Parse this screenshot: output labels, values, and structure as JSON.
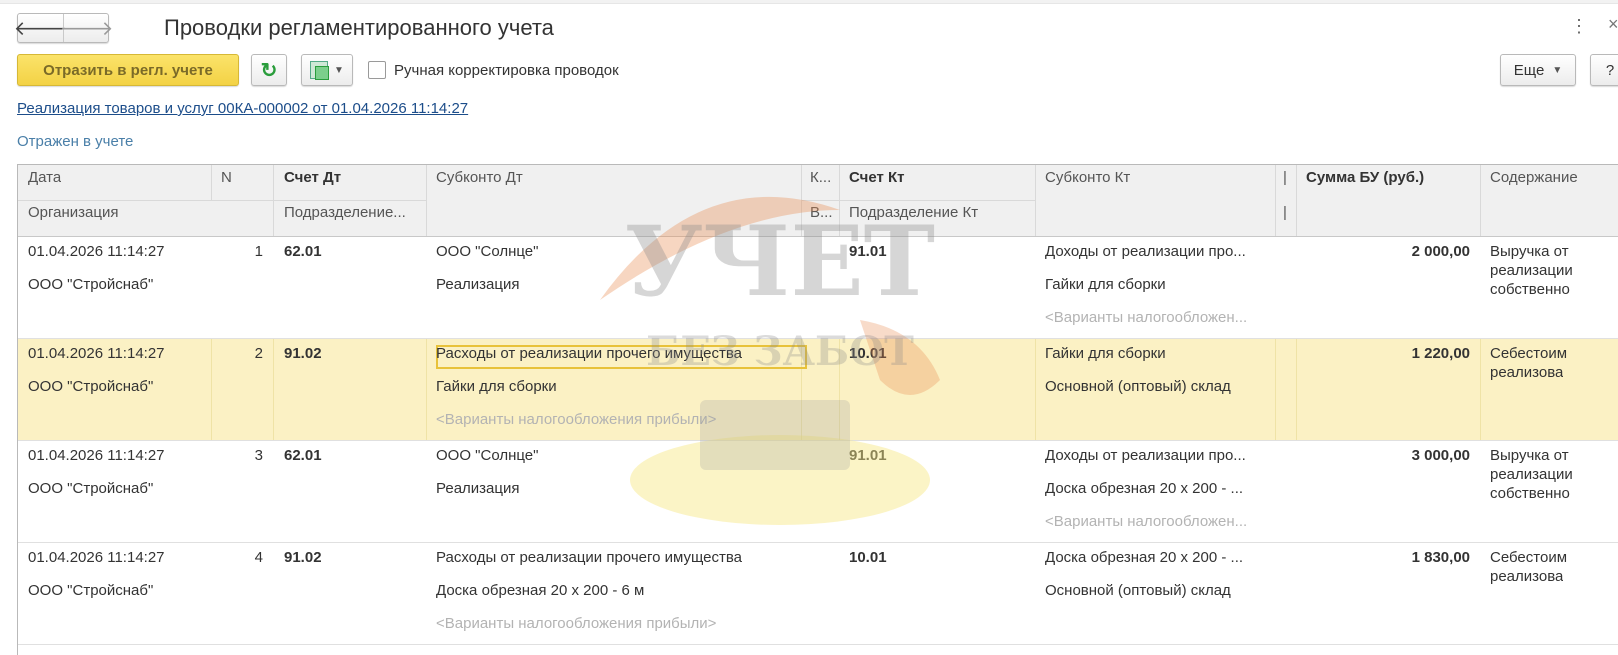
{
  "window": {
    "title": "Проводки регламентированного учета",
    "back_icon": "arrow-left-icon",
    "forward_icon": "arrow-right-icon"
  },
  "toolbar": {
    "post_label": "Отразить в регл. учете",
    "manual_label": "Ручная корректировка проводок",
    "more_label": "Еще",
    "help_label": "?"
  },
  "document_link": "Реализация товаров и услуг 00КА-000002 от 01.04.2026 11:14:27",
  "status": "Отражен в учете",
  "columns": {
    "date": "Дата",
    "n": "N",
    "account_dt": "Счет Дт",
    "subconto_dt": "Субконто Дт",
    "k": "К...",
    "account_kt": "Счет Кт",
    "subconto_kt": "Субконто Кт",
    "sep": "|",
    "amount": "Сумма БУ (руб.)",
    "content": "Содержание",
    "org": "Организация",
    "division_dt": "Подразделение...",
    "v": "В...",
    "division_kt": "Подразделение Кт"
  },
  "rows": [
    {
      "date": "01.04.2026 11:14:27",
      "n": "1",
      "dt": "62.01",
      "sub_dt1": "ООО \"Солнце\"",
      "sub_dt2": "Реализация",
      "sub_dt3": "",
      "kt": "91.01",
      "sub_kt1": "Доходы от реализации про...",
      "sub_kt2": "Гайки для сборки",
      "sub_kt3": "<Варианты налогообложен...",
      "org": "ООО \"Стройснаб\"",
      "amount": "2 000,00",
      "content1": "Выручка от",
      "content2": "реализации",
      "content3": "собственно"
    },
    {
      "date": "01.04.2026 11:14:27",
      "n": "2",
      "dt": "91.02",
      "sub_dt1": "Расходы от реализации прочего имущества",
      "sub_dt2": "Гайки для сборки",
      "sub_dt3": "<Варианты налогообложения прибыли>",
      "kt": "10.01",
      "sub_kt1": "Гайки для сборки",
      "sub_kt2": "Основной (оптовый) склад",
      "sub_kt3": "",
      "org": "ООО \"Стройснаб\"",
      "amount": "1 220,00",
      "content1": "Себестоим",
      "content2": "реализова",
      "content3": ""
    },
    {
      "date": "01.04.2026 11:14:27",
      "n": "3",
      "dt": "62.01",
      "sub_dt1": "ООО \"Солнце\"",
      "sub_dt2": "Реализация",
      "sub_dt3": "",
      "kt": "91.01",
      "sub_kt1": "Доходы от реализации про...",
      "sub_kt2": "Доска обрезная 20 х 200 - ...",
      "sub_kt3": "<Варианты налогообложен...",
      "org": "ООО \"Стройснаб\"",
      "amount": "3 000,00",
      "content1": "Выручка от",
      "content2": "реализации",
      "content3": "собственно"
    },
    {
      "date": "01.04.2026 11:14:27",
      "n": "4",
      "dt": "91.02",
      "sub_dt1": "Расходы от реализации прочего имущества",
      "sub_dt2": "Доска обрезная 20 х 200 - 6 м",
      "sub_dt3": "<Варианты налогообложения прибыли>",
      "kt": "10.01",
      "sub_kt1": "Доска обрезная 20 х 200 - ...",
      "sub_kt2": "Основной (оптовый) склад",
      "sub_kt3": "",
      "org": "ООО \"Стройснаб\"",
      "amount": "1 830,00",
      "content1": "Себестоим",
      "content2": "реализова",
      "content3": ""
    }
  ],
  "watermark": {
    "line1": "УЧЕТ",
    "line2": "БЕЗ ЗАБОТ"
  },
  "colors": {
    "primary_button": "#f3d245",
    "selected_row": "#fbf1c4",
    "link": "#1c4d8a",
    "status": "#4a7fa8"
  }
}
